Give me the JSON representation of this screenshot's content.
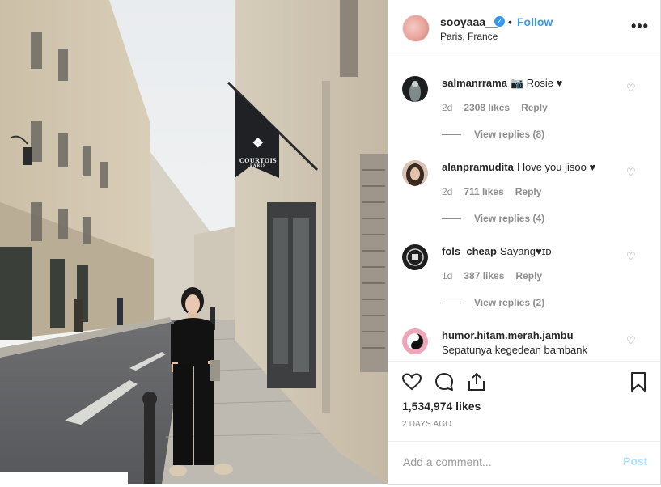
{
  "post": {
    "username": "sooyaaa__",
    "verified_glyph": "✓",
    "separator": "•",
    "follow_label": "Follow",
    "location": "Paris, France",
    "more_label": "•••",
    "photo_sign_text": "COURTOIS",
    "photo_sign_subtext": "PARIS"
  },
  "comments": [
    {
      "username": "salmanrrama",
      "text": "📷 Rosie ♥",
      "time": "2d",
      "likes": "2308 likes",
      "reply_label": "Reply",
      "view_replies": "View replies (8)"
    },
    {
      "username": "alanpramudita",
      "text": "I love you jisoo ♥",
      "time": "2d",
      "likes": "711 likes",
      "reply_label": "Reply",
      "view_replies": "View replies (4)"
    },
    {
      "username": "fols_cheap",
      "text": "Sayang♥ɪᴅ",
      "time": "1d",
      "likes": "387 likes",
      "reply_label": "Reply",
      "view_replies": "View replies (2)"
    },
    {
      "username": "humor.hitam.merah.jambu",
      "text": "Sepatunya kegedean bambank"
    }
  ],
  "icons": {
    "comment_like": "heart-outline-icon",
    "like": "heart-icon",
    "comment": "speech-bubble-icon",
    "share": "share-icon",
    "save": "bookmark-icon"
  },
  "heart_glyph": "♡",
  "stats": {
    "likes": "1,534,974 likes",
    "time_ago": "2 DAYS AGO"
  },
  "add_comment": {
    "placeholder": "Add a comment...",
    "post_label": "Post"
  },
  "colors": {
    "accent": "#3897f0",
    "post_disabled": "#b2dffc",
    "muted": "#8e8e8e"
  }
}
